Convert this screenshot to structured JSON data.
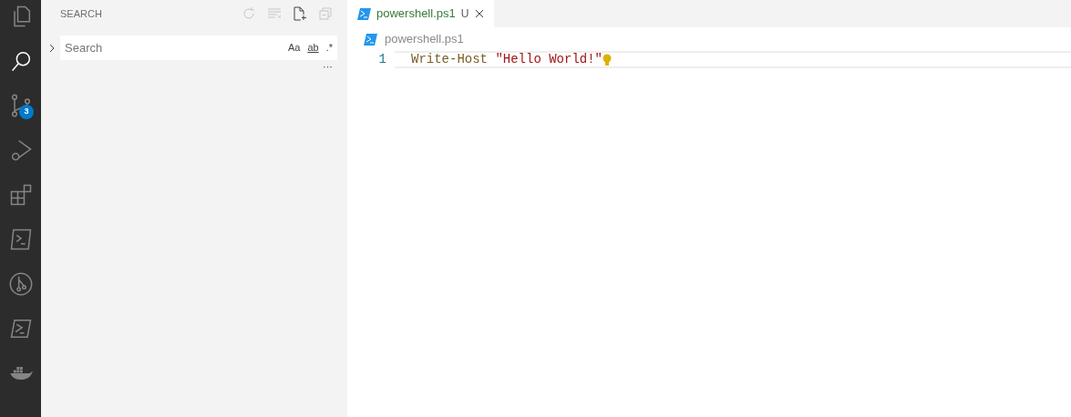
{
  "activity_bar": {
    "items": [
      {
        "kind": "explorer",
        "selected": false
      },
      {
        "kind": "search",
        "selected": true
      },
      {
        "kind": "scm",
        "selected": false,
        "badge": "3"
      },
      {
        "kind": "debug",
        "selected": false
      },
      {
        "kind": "extensions",
        "selected": false
      },
      {
        "kind": "terminal",
        "selected": false
      },
      {
        "kind": "git",
        "selected": false
      },
      {
        "kind": "powershell",
        "selected": false
      },
      {
        "kind": "docker",
        "selected": false
      }
    ]
  },
  "sidebar": {
    "title": "SEARCH",
    "search": {
      "placeholder": "Search",
      "expanded": false,
      "options": [
        "Aa",
        "ab",
        ".*"
      ]
    },
    "more": "···"
  },
  "tabs": [
    {
      "label": "powershell.ps1",
      "status": "U",
      "selected": true
    }
  ],
  "breadcrumb": "powershell.ps1",
  "editor": {
    "lines": [
      {
        "number": "1",
        "tokens": [
          {
            "kind": "command",
            "text": "Write-Host"
          },
          {
            "kind": "string",
            "text": "\"Hello World!\""
          }
        ]
      }
    ]
  }
}
